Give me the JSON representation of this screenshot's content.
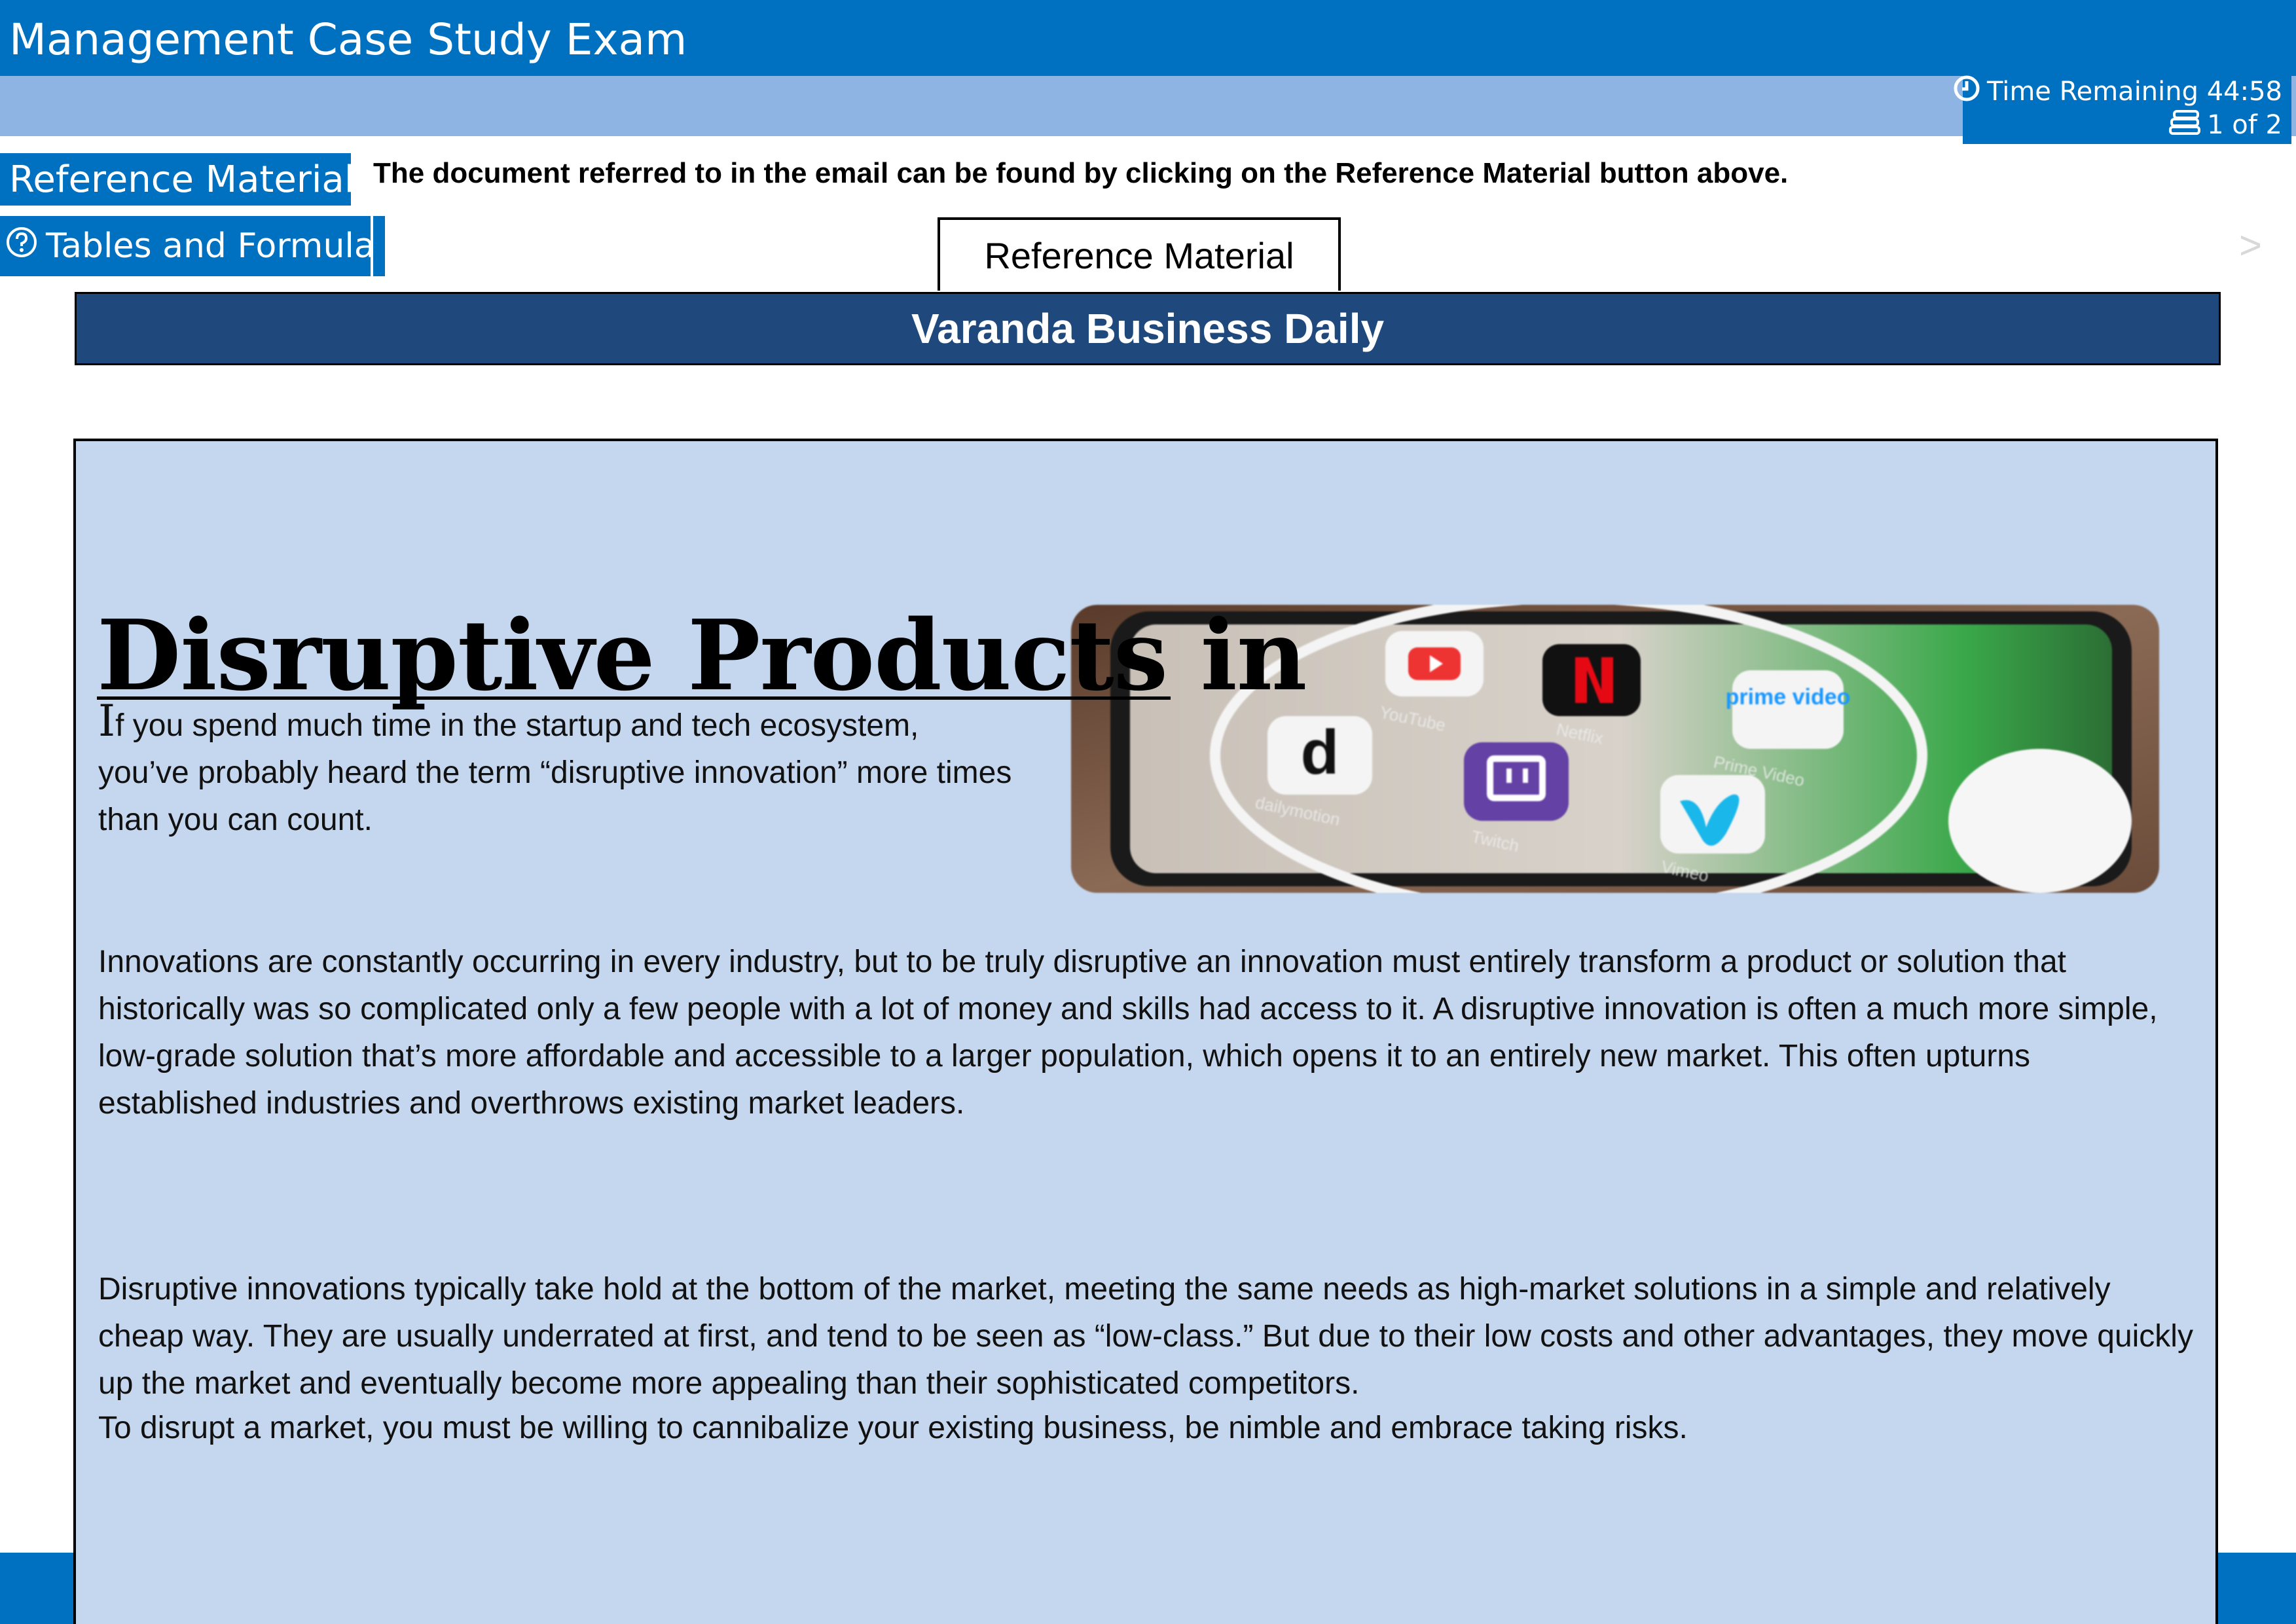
{
  "app": {
    "title": "Management Case Study Exam",
    "time_remaining": "Time Remaining 44:58",
    "pager": "1 of 2"
  },
  "nav": {
    "reference_button": "Reference Material",
    "tables_button": "Tables and Formulae",
    "instruction": "The document referred to in the email can be found by clicking on the Reference Material button above."
  },
  "tab": {
    "label": "Reference Material"
  },
  "article": {
    "publication": "Varanda Business Daily",
    "headline": "Disruptive Products in",
    "intro_first_letter": "I",
    "intro_rest": "f you spend much time in the startup and tech ecosystem, you’ve probably heard the term “disruptive innovation” more times than you can count.",
    "paragraphs": [
      "Innovations are constantly occurring in every industry, but to be truly disruptive an innovation must entirely transform a product or solution that historically was so complicated only a few people with a lot of money and skills had access to it. A disruptive innovation is often a much more simple, low-grade solution that’s more affordable and accessible to a larger population, which opens it to an entirely new market. This often upturns established industries and overthrows existing market leaders.",
      "Disruptive innovations typically take hold at the bottom of the market, meeting the same needs as high-market solutions in a simple and relatively cheap way. They are usually underrated at first, and tend to be seen as “low-class.” But due to their low costs and other advantages, they move quickly up the market and eventually become more appealing than their sophisticated competitors.",
      "To disrupt a market, you must be willing to cannibalize your existing business, be nimble and embrace taking risks."
    ],
    "photo_apps": [
      "YouTube",
      "Netflix",
      "Prime Video",
      "dailymotion",
      "Twitch",
      "Vimeo"
    ],
    "prime_logo_text": "prime video"
  },
  "colors": {
    "header_blue": "#0070c0",
    "subbar_blue": "#8db4e2",
    "banner_navy": "#1f497d",
    "article_bg": "#c5d7ee"
  }
}
